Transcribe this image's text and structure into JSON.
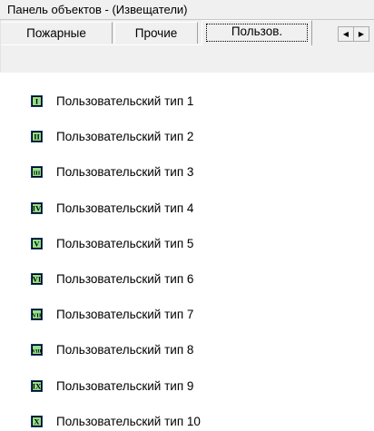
{
  "window": {
    "title": "Панель объектов - (Извещатели)"
  },
  "tabs": [
    {
      "label": "Пожарные",
      "active": false
    },
    {
      "label": "Прочие",
      "active": false
    },
    {
      "label": "Пользов.",
      "active": true
    }
  ],
  "tab_scroll": {
    "left_icon": "arrow-left-icon",
    "right_icon": "arrow-right-icon"
  },
  "items": [
    {
      "label": "Пользовательский тип 1",
      "numeral": "I",
      "icon": "user-type-1-icon"
    },
    {
      "label": "Пользовательский тип 2",
      "numeral": "II",
      "icon": "user-type-2-icon"
    },
    {
      "label": "Пользовательский тип 3",
      "numeral": "III",
      "icon": "user-type-3-icon"
    },
    {
      "label": "Пользовательский тип 4",
      "numeral": "IV",
      "icon": "user-type-4-icon"
    },
    {
      "label": "Пользовательский тип 5",
      "numeral": "V",
      "icon": "user-type-5-icon"
    },
    {
      "label": "Пользовательский тип 6",
      "numeral": "VI",
      "icon": "user-type-6-icon"
    },
    {
      "label": "Пользовательский тип 7",
      "numeral": "VII",
      "icon": "user-type-7-icon"
    },
    {
      "label": "Пользовательский тип 8",
      "numeral": "VIII",
      "icon": "user-type-8-icon"
    },
    {
      "label": "Пользовательский тип 9",
      "numeral": "IX",
      "icon": "user-type-9-icon"
    },
    {
      "label": "Пользовательский тип 10",
      "numeral": "X",
      "icon": "user-type-10-icon"
    }
  ],
  "colors": {
    "icon_fill": "#8fe08f",
    "icon_border": "#1a3d7a",
    "background": "#ffffff",
    "chrome": "#f0f0f0"
  }
}
